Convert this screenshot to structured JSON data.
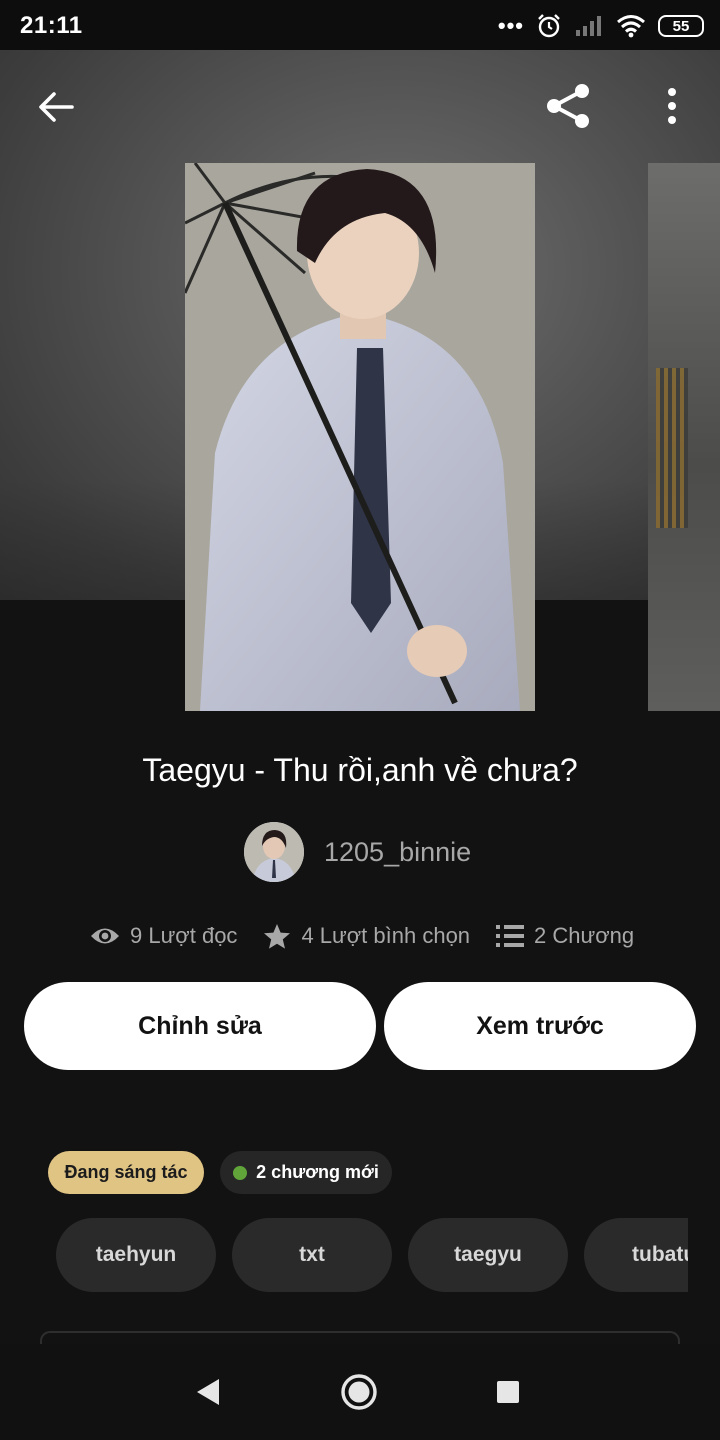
{
  "status_bar": {
    "time": "21:11",
    "dots": "•••",
    "battery": "55"
  },
  "story": {
    "title": "Taegyu - Thu rồi,anh về chưa?",
    "author": "1205_binnie",
    "stats": {
      "reads": "9 Lượt đọc",
      "votes": "4 Lượt bình chọn",
      "chapters": "2 Chương"
    }
  },
  "actions": {
    "edit_label": "Chỉnh sửa",
    "preview_label": "Xem trước"
  },
  "badges": {
    "status": "Đang sáng tác",
    "new_chapters": "2 chương mới"
  },
  "tags": [
    "taehyun",
    "txt",
    "taegyu",
    "tubatu"
  ],
  "colors": {
    "background": "#121212",
    "status_badge": "#e0c484",
    "new_dot": "#61a53a",
    "tag_bg": "#2a2a2a"
  },
  "icons": {
    "header": [
      "back-arrow-icon",
      "share-icon",
      "more-vertical-icon"
    ],
    "stats": [
      "eye-icon",
      "star-icon",
      "list-icon"
    ],
    "nav": [
      "nav-back-icon",
      "nav-home-icon",
      "nav-recents-icon"
    ]
  }
}
